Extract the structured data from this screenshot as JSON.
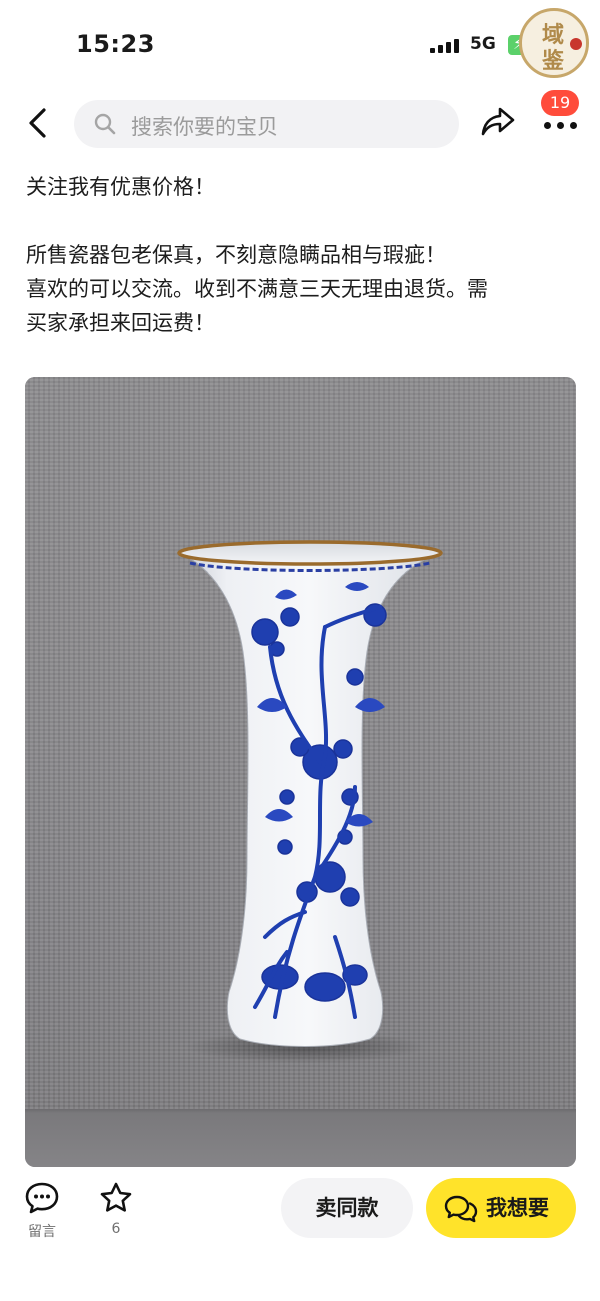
{
  "status_bar": {
    "time": "15:23",
    "network": "5G"
  },
  "watermark": {
    "chars": [
      "域",
      "鉴"
    ]
  },
  "nav": {
    "search_placeholder": "搜索你要的宝贝",
    "notification_count": "19"
  },
  "description": {
    "line1": "关注我有优惠价格！",
    "line2": "所售瓷器包老保真，不刻意隐瞒品相与瑕疵！",
    "line3": "喜欢的可以交流。收到不满意三天无理由退货。需",
    "line4": "买家承担来回运费！"
  },
  "bottom_bar": {
    "message_label": "留言",
    "favorite_count": "6",
    "same_style_label": "卖同款",
    "want_label": "我想要",
    "want_color": "#ffe32a",
    "badge_color": "#ff4c3b"
  },
  "icons": [
    "back-icon",
    "search-icon",
    "share-icon",
    "more-icon",
    "message-icon",
    "star-icon",
    "chat-icon"
  ]
}
